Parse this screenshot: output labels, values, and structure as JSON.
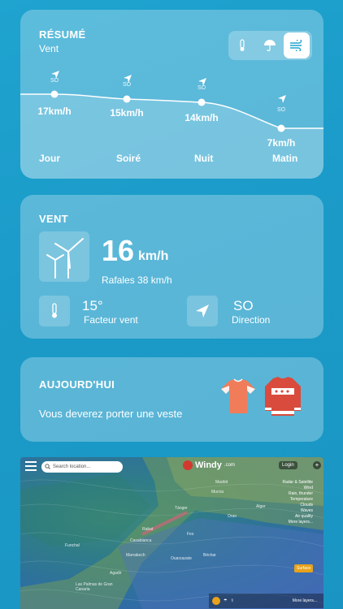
{
  "summary": {
    "title": "RÉSUMÉ",
    "subtitle": "Vent",
    "modes": [
      "temperature-icon",
      "umbrella-icon",
      "wind-icon"
    ],
    "active_mode": 2,
    "points": [
      {
        "period": "Jour",
        "speed": "17km/h",
        "direction": "SO",
        "value": 17
      },
      {
        "period": "Soiré",
        "speed": "15km/h",
        "direction": "SO",
        "value": 15
      },
      {
        "period": "Nuit",
        "speed": "14km/h",
        "direction": "SO",
        "value": 14
      },
      {
        "period": "Matin",
        "speed": "7km/h",
        "direction": "SO",
        "value": 7
      }
    ]
  },
  "wind": {
    "title": "VENT",
    "speed": "16",
    "unit": "km/h",
    "gusts": "Rafales 38 km/h",
    "feel_value": "15°",
    "feel_label": "Facteur vent",
    "dir_value": "SO",
    "dir_label": "Direction"
  },
  "today": {
    "title": "AUJOURD'HUI",
    "message": "Vous deverez porter une veste"
  },
  "map": {
    "search_placeholder": "Search location...",
    "brand": "Windy",
    "brand_suffix": ".com",
    "login": "Login",
    "layers": [
      "Radar & Satellite",
      "Wind",
      "Rain, thunder",
      "Temperature",
      "Clouds",
      "Waves",
      "Air quality",
      "More layers..."
    ],
    "surface": "Surface",
    "more_layers": "More layers...",
    "cities": [
      "Tánger",
      "Rabat",
      "Casablanca",
      "Marrakech",
      "Agadir",
      "Funchal",
      "Las Palmas de Gran Canaria",
      "Madrid",
      "Murcia",
      "Alger",
      "Oran",
      "Fes",
      "Ouarzazate",
      "Béchar"
    ]
  }
}
